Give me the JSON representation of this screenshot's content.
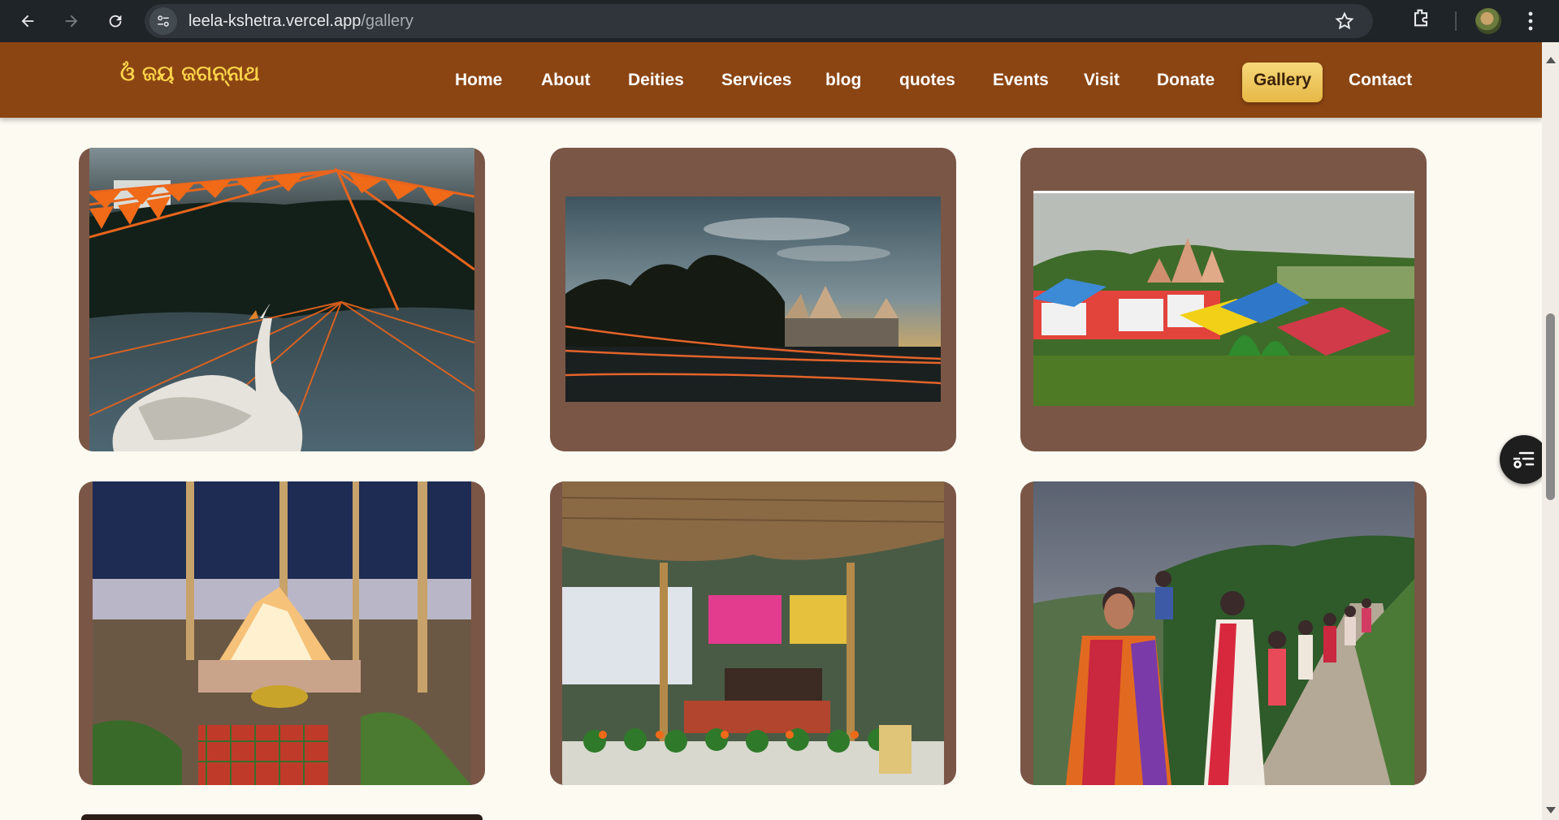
{
  "browser": {
    "url_host": "leela-kshetra.vercel.app",
    "url_path": "/gallery",
    "icons": [
      "back-icon",
      "forward-icon",
      "reload-icon",
      "site-settings-icon",
      "bookmark-star-icon",
      "extensions-icon",
      "profile-avatar",
      "menu-kebab-icon"
    ]
  },
  "site": {
    "brand": "ଓଁ ଜୟ ଜଗନ୍ନାଥ",
    "nav": [
      {
        "label": "Home"
      },
      {
        "label": "About"
      },
      {
        "label": "Deities"
      },
      {
        "label": "Services"
      },
      {
        "label": "blog"
      },
      {
        "label": "quotes"
      },
      {
        "label": "Events"
      },
      {
        "label": "Visit"
      },
      {
        "label": "Donate"
      },
      {
        "label": "Gallery"
      },
      {
        "label": "Contact"
      }
    ],
    "active_nav": "Gallery",
    "colors": {
      "header": "#8b4513",
      "brand": "#ffd54a",
      "active_tab": "#f0c95e",
      "card": "#7a5646",
      "page_bg": "#fdfaf2"
    }
  },
  "gallery": {
    "photos": [
      {
        "subject": "pond with swan and orange festoons"
      },
      {
        "subject": "temple across the pond at dusk"
      },
      {
        "subject": "temple complex with tents"
      },
      {
        "subject": "sacred fire ritual"
      },
      {
        "subject": "thatched shelter with offerings"
      },
      {
        "subject": "women in procession"
      }
    ]
  },
  "floating_button": {
    "icon": "settings-list-icon"
  }
}
